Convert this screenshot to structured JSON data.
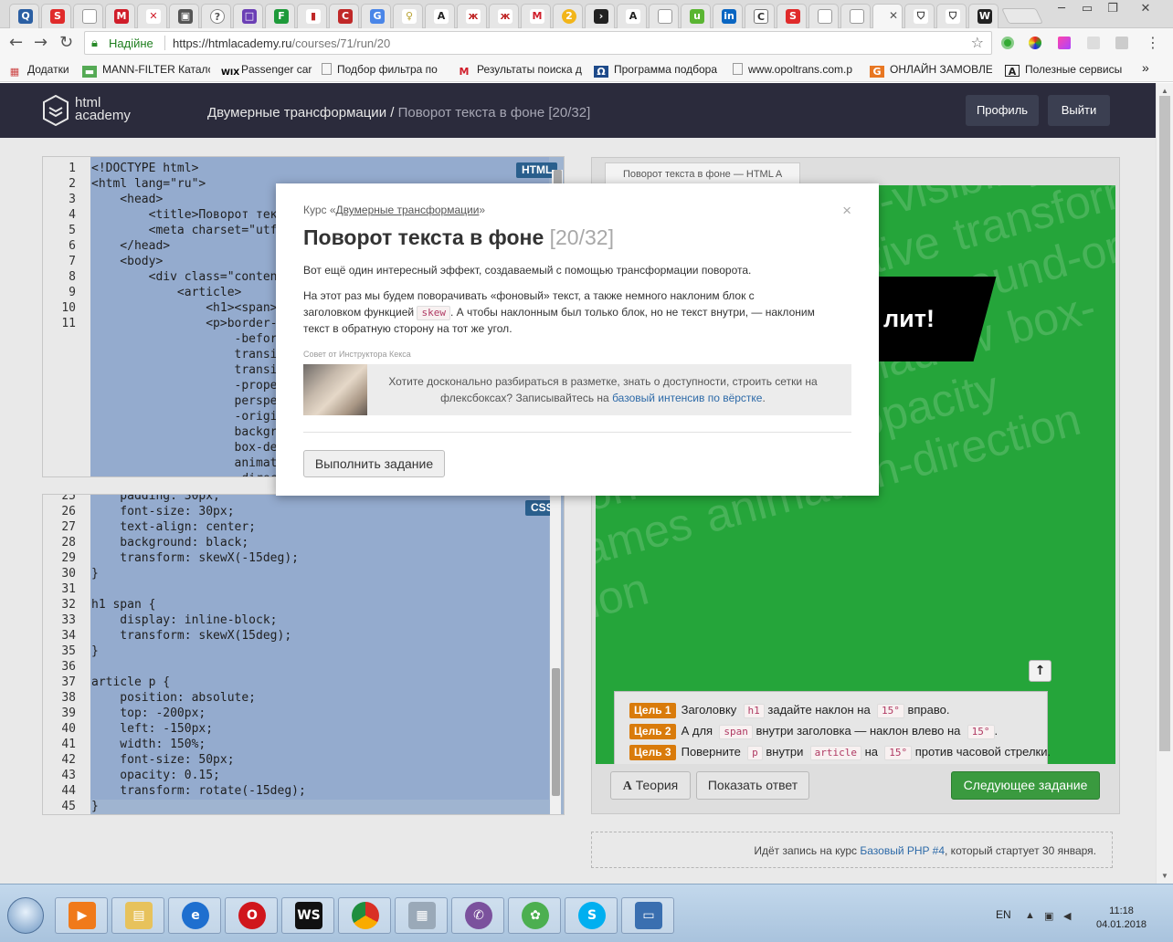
{
  "browser": {
    "address": {
      "secure_label": "Надійне",
      "url_host": "https://htmlacademy.ru",
      "url_path": "/courses/71/run/20"
    },
    "bookmarks": [
      {
        "label": "Додатки"
      },
      {
        "label": "MANN-FILTER Катало"
      },
      {
        "label": "Passenger car"
      },
      {
        "label": "Подбор фильтра по"
      },
      {
        "label": "Результаты поиска д"
      },
      {
        "label": "Программа подбора"
      },
      {
        "label": "www.opoltrans.com.p"
      },
      {
        "label": "ОНЛАЙН ЗАМОВЛЕ"
      },
      {
        "label": "Полезные сервисы"
      }
    ],
    "bookmarks_more": "»"
  },
  "header": {
    "logo_line1": "html",
    "logo_line2": "academy",
    "breadcrumb_course": "Двумерные трансформации",
    "breadcrumb_sep": "/",
    "breadcrumb_current": "Поворот текста в фоне",
    "breadcrumb_progress": "[20/32]",
    "profile_label": "Профиль",
    "logout_label": "Выйти"
  },
  "html_editor": {
    "badge": "HTML",
    "lines": [
      {
        "n": "1",
        "code": "<!DOCTYPE html>"
      },
      {
        "n": "2",
        "code": "<html lang=\"ru\">"
      },
      {
        "n": "3",
        "code": "    <head>"
      },
      {
        "n": "4",
        "code": "        <title>Поворот текс"
      },
      {
        "n": "5",
        "code": "        <meta charset=\"utf"
      },
      {
        "n": "6",
        "code": "    </head>"
      },
      {
        "n": "7",
        "code": "    <body>"
      },
      {
        "n": "8",
        "code": "        <div class=\"content"
      },
      {
        "n": "9",
        "code": "            <article>"
      },
      {
        "n": "10",
        "code": "                <h1><span>"
      },
      {
        "n": "11",
        "code": "                <p>border-r"
      },
      {
        "n": "",
        "code": "                    -befor"
      },
      {
        "n": "",
        "code": "                    transi"
      },
      {
        "n": "",
        "code": "                    transi"
      },
      {
        "n": "",
        "code": "                    -prope"
      },
      {
        "n": "",
        "code": "                    perspe"
      },
      {
        "n": "",
        "code": "                    -origi"
      },
      {
        "n": "",
        "code": "                    backgr"
      },
      {
        "n": "",
        "code": "                    box-de"
      },
      {
        "n": "",
        "code": "                    animat"
      },
      {
        "n": "",
        "code": "                    -direc"
      }
    ]
  },
  "css_editor": {
    "badge": "CSS",
    "lines": [
      {
        "n": "25",
        "code": "    padding: 30px;"
      },
      {
        "n": "26",
        "code": "    font-size: 30px;"
      },
      {
        "n": "27",
        "code": "    text-align: center;"
      },
      {
        "n": "28",
        "code": "    background: black;"
      },
      {
        "n": "29",
        "code": "    transform: skewX(-15deg);"
      },
      {
        "n": "30",
        "code": "}"
      },
      {
        "n": "31",
        "code": ""
      },
      {
        "n": "32",
        "code": "h1 span {"
      },
      {
        "n": "33",
        "code": "    display: inline-block;"
      },
      {
        "n": "34",
        "code": "    transform: skewX(15deg);"
      },
      {
        "n": "35",
        "code": "}"
      },
      {
        "n": "36",
        "code": ""
      },
      {
        "n": "37",
        "code": "article p {"
      },
      {
        "n": "38",
        "code": "    position: absolute;"
      },
      {
        "n": "39",
        "code": "    top: -200px;"
      },
      {
        "n": "40",
        "code": "    left: -150px;"
      },
      {
        "n": "41",
        "code": "    width: 150%;"
      },
      {
        "n": "42",
        "code": "    font-size: 50px;"
      },
      {
        "n": "43",
        "code": "    opacity: 0.15;"
      },
      {
        "n": "44",
        "code": "    transform: rotate(-15deg);"
      },
      {
        "n": "45",
        "code": "}"
      }
    ]
  },
  "preview": {
    "tab_title": "Поворот текста в фоне — HTML A",
    "heading_fragment": "лит!",
    "background_text": "transition transform transition-duration transition-timing backface-visibility transform-origin perspective transform-style background-clip background-origin background-size box-shadow box-decoration animation opacity @keyframes animation-direction animation",
    "goals": [
      {
        "label": "Цель 1",
        "pre": "Заголовку",
        "code1": "h1",
        "mid": "задайте наклон на",
        "code2": "15°",
        "post": "вправо."
      },
      {
        "label": "Цель 2",
        "pre": "А для",
        "code1": "span",
        "mid": "внутри заголовка — наклон влево на",
        "code2": "15°",
        "post": "."
      },
      {
        "label": "Цель 3",
        "pre": "Поверните",
        "code1": "p",
        "mid": "внутри",
        "code2": "article",
        "mid2": "на",
        "code3": "15°",
        "post": "против часовой стрелки."
      }
    ],
    "theory_label": "Теория",
    "show_answer_label": "Показать ответ",
    "next_label": "Следующее задание"
  },
  "promo": {
    "pre": "Идёт запись на курс",
    "link": "Базовый PHP #4",
    "post": ", который стартует 30 января."
  },
  "modal": {
    "course_prefix": "Курс «",
    "course_name": "Двумерные трансформации",
    "course_suffix": "»",
    "title": "Поворот текста в фоне",
    "progress": "[20/32]",
    "para1": "Вот ещё один интересный эффект, создаваемый с помощью трансформации поворота.",
    "para2_a": "На этот раз мы будем поворачивать «фоновый» текст, а также немного наклоним блок с заголовком функцией",
    "para2_code": "skew",
    "para2_b": ". А чтобы наклонным был только блок, но не текст внутри, — наклоним текст в обратную сторону на тот же угол.",
    "tip_label": "Совет от Инструктора Кекса",
    "tip_text": "Хотите досконально разбираться в разметке, знать о доступности, строить сетки на флексбоксах? Записывайтесь на",
    "tip_link": "базовый интенсив по вёрстке",
    "tip_end": ".",
    "run_label": "Выполнить задание",
    "close_glyph": "×"
  },
  "taskbar": {
    "lang": "EN",
    "time": "11:18",
    "date": "04.01.2018"
  }
}
